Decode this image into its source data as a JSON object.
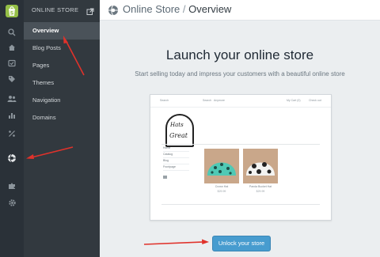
{
  "colors": {
    "rail_bg": "#2a3138",
    "sidebar_bg": "#32393f",
    "active_bg": "#4a5259",
    "brand": "#95bf47",
    "button": "#479ccf",
    "annotation": "#e0322b"
  },
  "rail": {
    "icons": [
      "shopify-logo-icon",
      "search-icon",
      "home-icon",
      "orders-icon",
      "products-icon",
      "customers-icon",
      "reports-icon",
      "discounts-icon",
      "online-store-icon",
      "apps-icon",
      "settings-icon"
    ]
  },
  "sidebar": {
    "title": "ONLINE STORE",
    "items": [
      {
        "label": "Overview",
        "active": true
      },
      {
        "label": "Blog Posts",
        "active": false
      },
      {
        "label": "Pages",
        "active": false
      },
      {
        "label": "Themes",
        "active": false
      },
      {
        "label": "Navigation",
        "active": false
      },
      {
        "label": "Domains",
        "active": false
      }
    ]
  },
  "header": {
    "section": "Online Store",
    "separator": "/",
    "page": "Overview"
  },
  "main": {
    "headline": "Launch your online store",
    "subline": "Start selling today and impress your customers with a beautiful online store",
    "button_label": "Unlock your store"
  },
  "preview": {
    "nav_search": "Search",
    "nav_left": "Search",
    "nav_mid": "Anymore",
    "nav_account": "My Cart (0)",
    "nav_checkout": "Check out",
    "logo_line1": "Hats",
    "logo_line2": "Great",
    "menu": [
      "Home",
      "Catalog",
      "Blog",
      "Frontpage"
    ],
    "products": [
      {
        "name": "Crown Hat",
        "price": "$29.99"
      },
      {
        "name": "Panda Bucket Hat",
        "price": "$29.99"
      }
    ]
  }
}
